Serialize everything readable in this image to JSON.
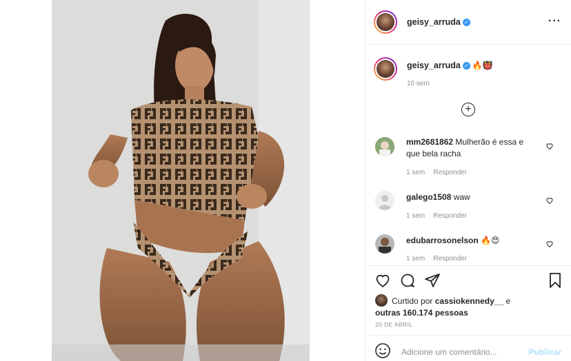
{
  "post": {
    "username": "geisy_arruda",
    "verified": true,
    "caption_emojis": "🔥👹",
    "caption_age": "10 sem",
    "load_more_icon": "plus-circle-icon"
  },
  "comments": [
    {
      "user": "mm2681862",
      "text": "Mulherão é essa e que bela racha",
      "age": "1 sem",
      "reply": "Responder"
    },
    {
      "user": "galego1508",
      "text": "waw",
      "age": "1 sem",
      "reply": "Responder"
    },
    {
      "user": "edubarrosonelson",
      "text": "🔥😍",
      "age": "1 sem",
      "reply": "Responder"
    }
  ],
  "likes": {
    "prefix": "Curtido por",
    "user": "cassiokennedy__",
    "conj": "e",
    "others": "outras 160.174 pessoas"
  },
  "date": "20 DE ABRIL",
  "comment_input": {
    "placeholder": "Adicione um comentário...",
    "publish_label": "Publicar"
  },
  "colors": {
    "link_blue": "#3897f0",
    "muted": "#8e8e8e",
    "text": "#262626",
    "publish_disabled": "#b2dffc"
  }
}
